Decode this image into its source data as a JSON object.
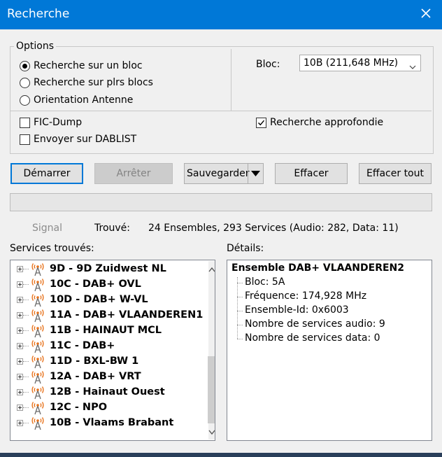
{
  "window": {
    "title": "Recherche"
  },
  "options": {
    "legend": "Options",
    "radios": [
      {
        "label": "Recherche sur un bloc",
        "checked": true
      },
      {
        "label": "Recherche sur plrs blocs",
        "checked": false
      },
      {
        "label": "Orientation Antenne",
        "checked": false
      }
    ],
    "bloc_label": "Bloc:",
    "bloc_value": "10B (211,648 MHz)",
    "checkboxes": {
      "fic_dump": {
        "label": "FIC-Dump",
        "checked": false
      },
      "dablist": {
        "label": "Envoyer sur DABLIST",
        "checked": false
      },
      "approfondie": {
        "label": "Recherche approfondie",
        "checked": true
      }
    }
  },
  "buttons": {
    "start": "Démarrer",
    "stop": "Arrêter",
    "save": "Sauvegarder",
    "clear": "Effacer",
    "clear_all": "Effacer tout"
  },
  "status": {
    "signal": "Signal",
    "found_label": "Trouvé:",
    "found_value": "24 Ensembles, 293 Services (Audio: 282, Data: 11)"
  },
  "services": {
    "label": "Services trouvés:",
    "items": [
      "9D - 9D Zuidwest NL",
      "10C - DAB+ OVL",
      "10D - DAB+ W-VL",
      "11A - DAB+ VLAANDEREN1",
      "11B - HAINAUT MCL",
      "11C - DAB+",
      "11D - BXL-BW 1",
      "12A - DAB+ VRT",
      "12B - Hainaut Ouest",
      "12C - NPO",
      "10B - Vlaams Brabant"
    ]
  },
  "details": {
    "label": "Détails:",
    "title": "Ensemble DAB+ VLAANDEREN2",
    "rows": [
      "Bloc: 5A",
      "Fréquence: 174,928 MHz",
      "Ensemble-Id: 0x6003",
      "Nombre de services audio: 9",
      "Nombre de services data: 0"
    ]
  },
  "colors": {
    "titlebar": "#0078d7",
    "accent": "#0078d7",
    "antenna": "#e8731c"
  }
}
